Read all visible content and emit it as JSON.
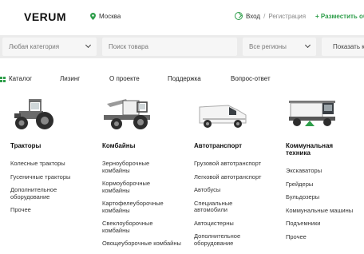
{
  "header": {
    "logo": "VERUM",
    "city": "Москва",
    "login": "Вход",
    "separator": "/",
    "register": "Регистрация",
    "post_ad": "+ Разместить об"
  },
  "search": {
    "category_placeholder": "Любая категория",
    "query_placeholder": "Поиск товара",
    "region_placeholder": "Все регионы",
    "show_label": "Показать к"
  },
  "nav": {
    "catalog": "Каталог",
    "items": [
      "Лизинг",
      "О проекте",
      "Поддержка",
      "Вопрос-ответ"
    ]
  },
  "catalog": [
    {
      "title": "Тракторы",
      "items": [
        "Колесные тракторы",
        "Гусеничные тракторы",
        "Дополнительное оборудование",
        "Прочее"
      ]
    },
    {
      "title": "Комбайны",
      "items": [
        "Зерноуборочные комбайны",
        "Кормоуборочные комбайны",
        "Картофелеуборочные комбайны",
        "Свеклоуборочные комбайны",
        "Овощеуборочные комбайны"
      ]
    },
    {
      "title": "Автотранспорт",
      "items": [
        "Грузовой автотранспорт",
        "Легковой автотранспорт",
        "Автобусы",
        "Специальные автомобили",
        "Автоцистерны",
        "Дополнительное оборудование"
      ]
    },
    {
      "title": "Коммунальная техника",
      "items": [
        "Экскаваторы",
        "Грейдеры",
        "Бульдозеры",
        "Коммунальные машины",
        "Подъемники",
        "Прочее"
      ]
    }
  ],
  "colors": {
    "accent": "#2e9e4a"
  }
}
